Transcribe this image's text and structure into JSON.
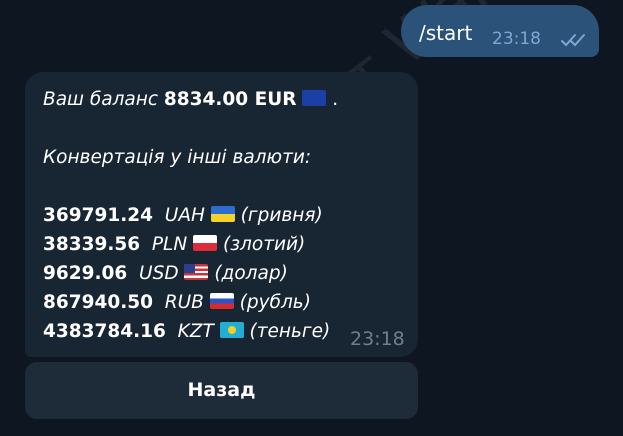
{
  "watermark": "Телеграм бот Wallet",
  "outgoing": {
    "text": "/start",
    "time": "23:18"
  },
  "incoming": {
    "balance_prefix": "Ваш баланс",
    "balance_value": "8834.00 EUR",
    "balance_suffix": ".",
    "conversion_title": "Конвертація у інші валюти:",
    "rows": [
      {
        "amount": "369791.24",
        "code": "UAH",
        "name": "(гривня)"
      },
      {
        "amount": "38339.56",
        "code": "PLN",
        "name": "(злотий)"
      },
      {
        "amount": "9629.06",
        "code": "USD",
        "name": "(долар)"
      },
      {
        "amount": "867940.50",
        "code": "RUB",
        "name": "(рубль)"
      },
      {
        "amount": "4383784.16",
        "code": "KZT",
        "name": "(теньге)"
      }
    ],
    "time": "23:18"
  },
  "keyboard": {
    "back_label": "Назад"
  },
  "colors": {
    "background": "#0e1621",
    "outgoing_bubble": "#2b5278",
    "incoming_bubble": "#182533",
    "button": "#1e2c3a",
    "accent": "#7da8d3"
  }
}
